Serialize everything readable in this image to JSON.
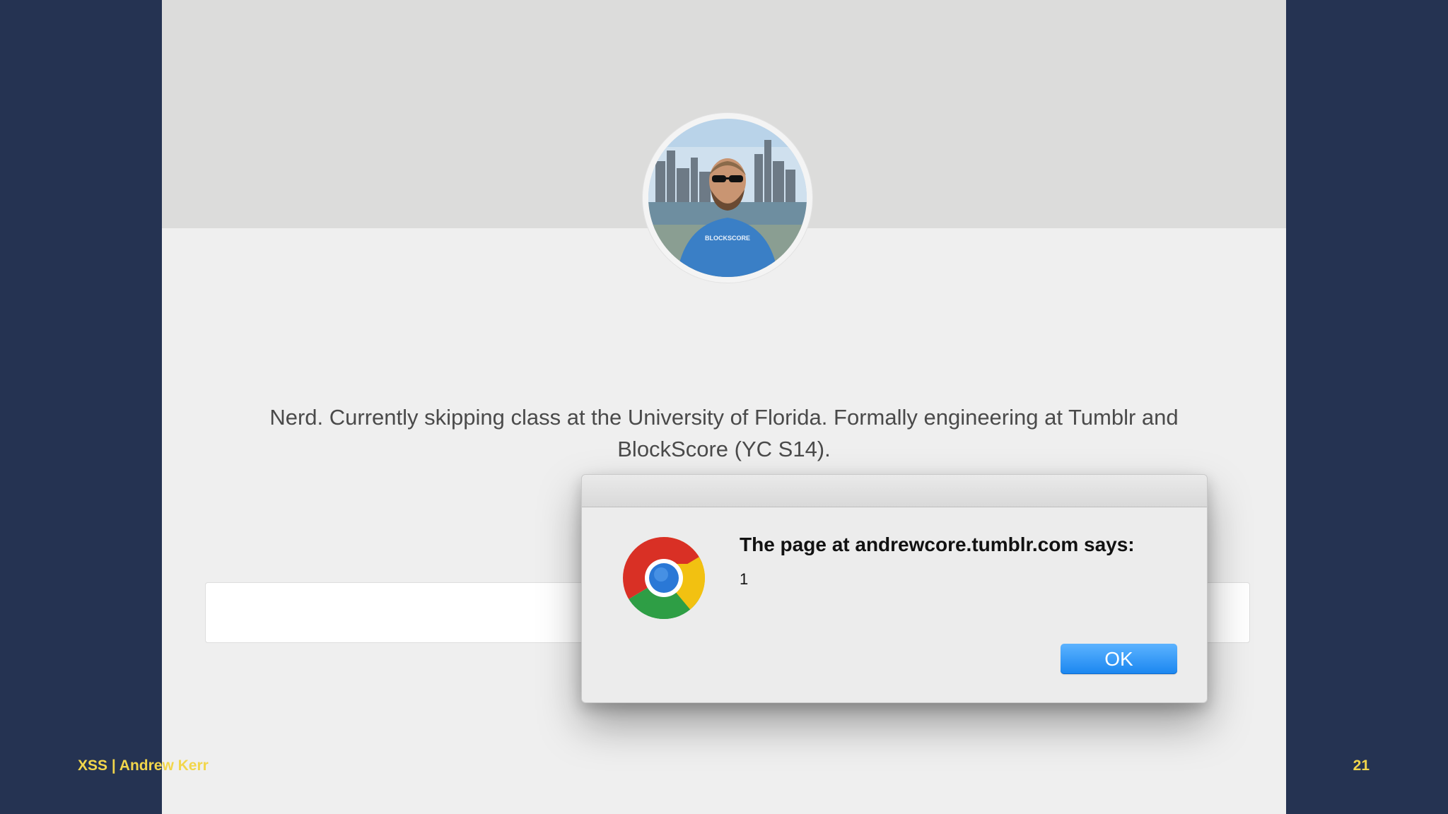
{
  "profile": {
    "bio_line1": "Nerd. Currently skipping class at the University of Florida. Formally engineering at Tumblr and",
    "bio_line2": "BlockScore (YC S14).",
    "shirt_text": "BLOCKSCORE"
  },
  "alert": {
    "heading": "The page at andrewcore.tumblr.com says:",
    "message": "1",
    "ok_label": "OK",
    "icon": "chrome-logo-icon"
  },
  "slide": {
    "footer_title": "XSS | Andrew Kerr",
    "page_number": "21"
  },
  "colors": {
    "background": "#253352",
    "footer_text": "#f2d64b",
    "ok_button": "#1a86f0"
  }
}
